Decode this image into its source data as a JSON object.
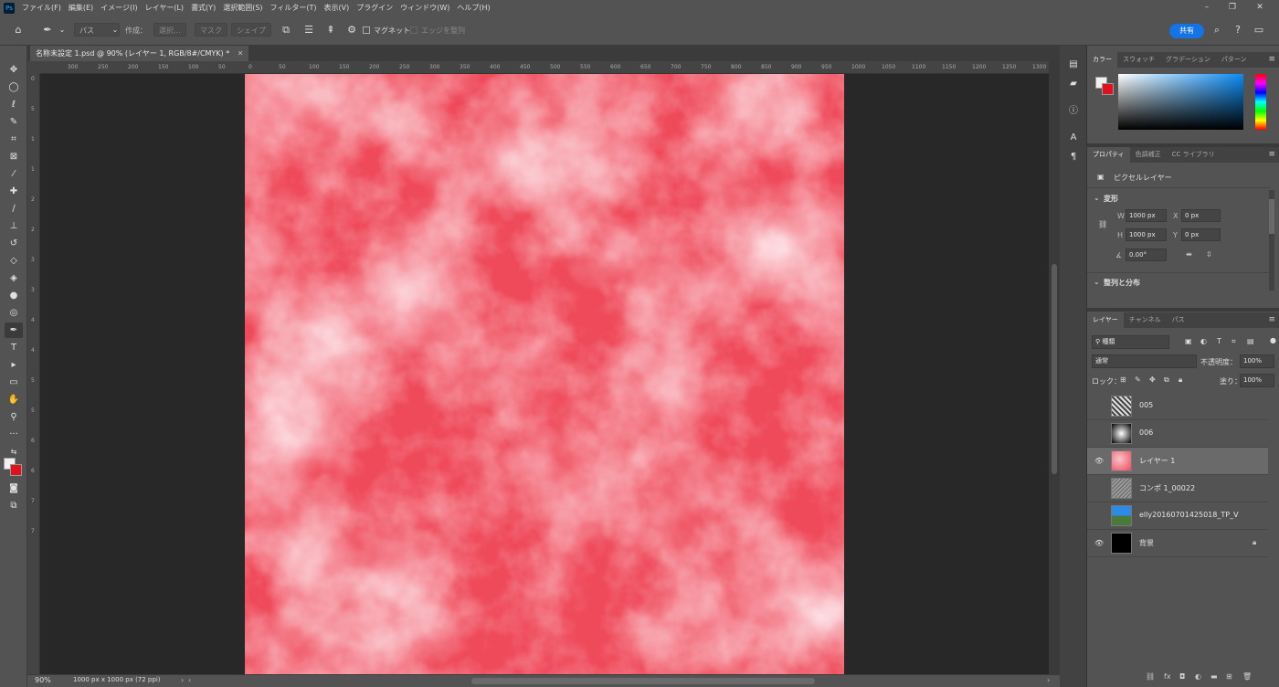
{
  "app": {
    "logo": "Ps"
  },
  "menu": [
    "ファイル(F)",
    "編集(E)",
    "イメージ(I)",
    "レイヤー(L)",
    "書式(Y)",
    "選択範囲(S)",
    "フィルター(T)",
    "表示(V)",
    "プラグイン",
    "ウィンドウ(W)",
    "ヘルプ(H)"
  ],
  "window_controls": {
    "minimize": "–",
    "restore": "❐",
    "close": "✕"
  },
  "options": {
    "mode_select": "パス",
    "create_label": "作成：",
    "select_btn": "選択...",
    "mask_btn": "マスク",
    "shape_btn": "シェイプ",
    "magnet_label": "マグネット",
    "align_edges_label": "エッジを整列",
    "share": "共有"
  },
  "document": {
    "tab_title": "名称未設定 1.psd @ 90% (レイヤー 1, RGB/8#/CMYK) *",
    "zoom": "90%",
    "info": "1000 px x 1000 px (72 ppi)",
    "canvas_color": "#ef4a5a"
  },
  "ruler": {
    "h_labels": [
      "300",
      "250",
      "200",
      "150",
      "100",
      "50",
      "0",
      "50",
      "100",
      "150",
      "200",
      "250",
      "300",
      "350",
      "400",
      "450",
      "500",
      "550",
      "600",
      "650",
      "700",
      "750",
      "800",
      "850",
      "900",
      "950",
      "1000",
      "1050",
      "1100",
      "1150",
      "1200",
      "1250",
      "1300"
    ],
    "v_labels": [
      "0",
      "5",
      "1",
      "1",
      "2",
      "2",
      "3",
      "3",
      "4",
      "4",
      "5",
      "5",
      "6",
      "6",
      "7",
      "7"
    ]
  },
  "tools": [
    "move-icon",
    "ellipse-select-icon",
    "lasso-icon",
    "quick-select-icon",
    "crop-icon",
    "frame-icon",
    "eyedropper-icon",
    "spot-heal-icon",
    "brush-icon",
    "stamp-icon",
    "history-brush-icon",
    "eraser-icon",
    "bucket-icon",
    "blur-icon",
    "dodge-icon",
    "pen-icon",
    "type-icon",
    "path-select-icon",
    "rectangle-icon",
    "hand-icon",
    "zoom-icon",
    "more-icon"
  ],
  "color_panel": {
    "tabs": [
      "カラー",
      "スウォッチ",
      "グラデーション",
      "パターン"
    ],
    "foreground": "#f0f0f0",
    "background": "#e0101c"
  },
  "properties_panel": {
    "tabs": [
      "プロパティ",
      "色調補正",
      "CC ライブラリ"
    ],
    "layer_type": "ピクセルレイヤー",
    "transform_title": "変形",
    "w_label": "W",
    "w_value": "1000 px",
    "h_label": "H",
    "h_value": "1000 px",
    "x_label": "X",
    "x_value": "0 px",
    "y_label": "Y",
    "y_value": "0 px",
    "angle_value": "0.00°",
    "align_title": "整列と分布"
  },
  "layers_panel": {
    "tabs": [
      "レイヤー",
      "チャンネル",
      "パス"
    ],
    "filter_kind": "種類",
    "blend_mode": "通常",
    "opacity_label": "不透明度：",
    "opacity_value": "100%",
    "lock_label": "ロック：",
    "fill_label": "塗り：",
    "fill_value": "100%",
    "layers": [
      {
        "name": "005",
        "visible": false,
        "thumb": "#bcbcbc"
      },
      {
        "name": "006",
        "visible": false,
        "thumb": "#6e6e6e"
      },
      {
        "name": "レイヤー 1",
        "visible": true,
        "selected": true,
        "thumb": "#ee5a6a"
      },
      {
        "name": "コンポ 1_00022",
        "visible": false,
        "thumb": "#9a9a9a"
      },
      {
        "name": "elly20160701425018_TP_V",
        "visible": false,
        "thumb": "#3a8fd9"
      },
      {
        "name": "背景",
        "visible": true,
        "locked": true,
        "thumb": "#000000"
      }
    ]
  }
}
